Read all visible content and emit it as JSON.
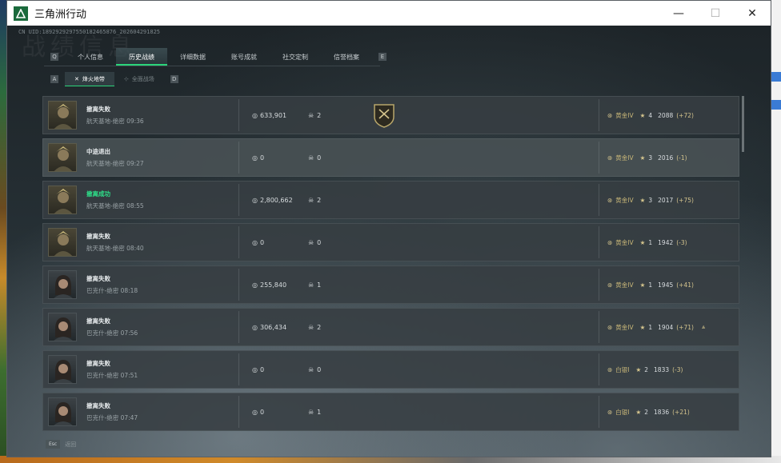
{
  "window": {
    "title": "三角洲行动",
    "minimize": "—",
    "maximize": "☐",
    "close": "✕"
  },
  "header": {
    "uid": "CN UID:1892929297550182465876_202604291825",
    "page_title": "战绩信息"
  },
  "tabs": {
    "prev_key": "Q",
    "next_key": "E",
    "items": [
      {
        "label": "个人信息",
        "active": false
      },
      {
        "label": "历史战绩",
        "active": true
      },
      {
        "label": "详细数据",
        "active": false
      },
      {
        "label": "账号成就",
        "active": false
      },
      {
        "label": "社交定制",
        "active": false
      },
      {
        "label": "信誉档案",
        "active": false
      }
    ]
  },
  "subtabs": {
    "prev_key": "A",
    "next_key": "D",
    "items": [
      {
        "label": "烽火地带",
        "active": true
      },
      {
        "label": "全面战场",
        "active": false
      }
    ]
  },
  "matches": [
    {
      "result": "撤离失败",
      "success": false,
      "map": "航天基地-绝密 09:36",
      "money": "633,901",
      "kills": "2",
      "badge": true,
      "rank": "黄金IV",
      "stars": "4",
      "score": "2088",
      "delta": "(+72)",
      "portrait": "male",
      "chevron": false
    },
    {
      "result": "中途退出",
      "success": false,
      "map": "航天基地-绝密 09:27",
      "money": "0",
      "kills": "0",
      "badge": false,
      "rank": "黄金IV",
      "stars": "3",
      "score": "2016",
      "delta": "(-1)",
      "portrait": "male",
      "chevron": false
    },
    {
      "result": "撤离成功",
      "success": true,
      "map": "航天基地-绝密 08:55",
      "money": "2,800,662",
      "kills": "2",
      "badge": false,
      "rank": "黄金IV",
      "stars": "3",
      "score": "2017",
      "delta": "(+75)",
      "portrait": "male",
      "chevron": false
    },
    {
      "result": "撤离失败",
      "success": false,
      "map": "航天基地-绝密 08:40",
      "money": "0",
      "kills": "0",
      "badge": false,
      "rank": "黄金IV",
      "stars": "1",
      "score": "1942",
      "delta": "(-3)",
      "portrait": "male",
      "chevron": false
    },
    {
      "result": "撤离失败",
      "success": false,
      "map": "巴克什-绝密 08:18",
      "money": "255,840",
      "kills": "1",
      "badge": false,
      "rank": "黄金IV",
      "stars": "1",
      "score": "1945",
      "delta": "(+41)",
      "portrait": "female",
      "chevron": false
    },
    {
      "result": "撤离失败",
      "success": false,
      "map": "巴克什-绝密 07:56",
      "money": "306,434",
      "kills": "2",
      "badge": false,
      "rank": "黄金IV",
      "stars": "1",
      "score": "1904",
      "delta": "(+71)",
      "portrait": "female",
      "chevron": true
    },
    {
      "result": "撤离失败",
      "success": false,
      "map": "巴克什-绝密 07:51",
      "money": "0",
      "kills": "0",
      "badge": false,
      "rank": "白银I",
      "stars": "2",
      "score": "1833",
      "delta": "(-3)",
      "portrait": "female",
      "chevron": false
    },
    {
      "result": "撤离失败",
      "success": false,
      "map": "巴克什-绝密 07:47",
      "money": "0",
      "kills": "1",
      "badge": false,
      "rank": "白银I",
      "stars": "2",
      "score": "1836",
      "delta": "(+21)",
      "portrait": "female",
      "chevron": false
    }
  ],
  "footer": {
    "esc_key": "Esc",
    "back_label": "返回"
  },
  "colors": {
    "accent_green": "#2bd47a",
    "success_green": "#2ee08a",
    "rank_gold": "#d4c48d"
  }
}
